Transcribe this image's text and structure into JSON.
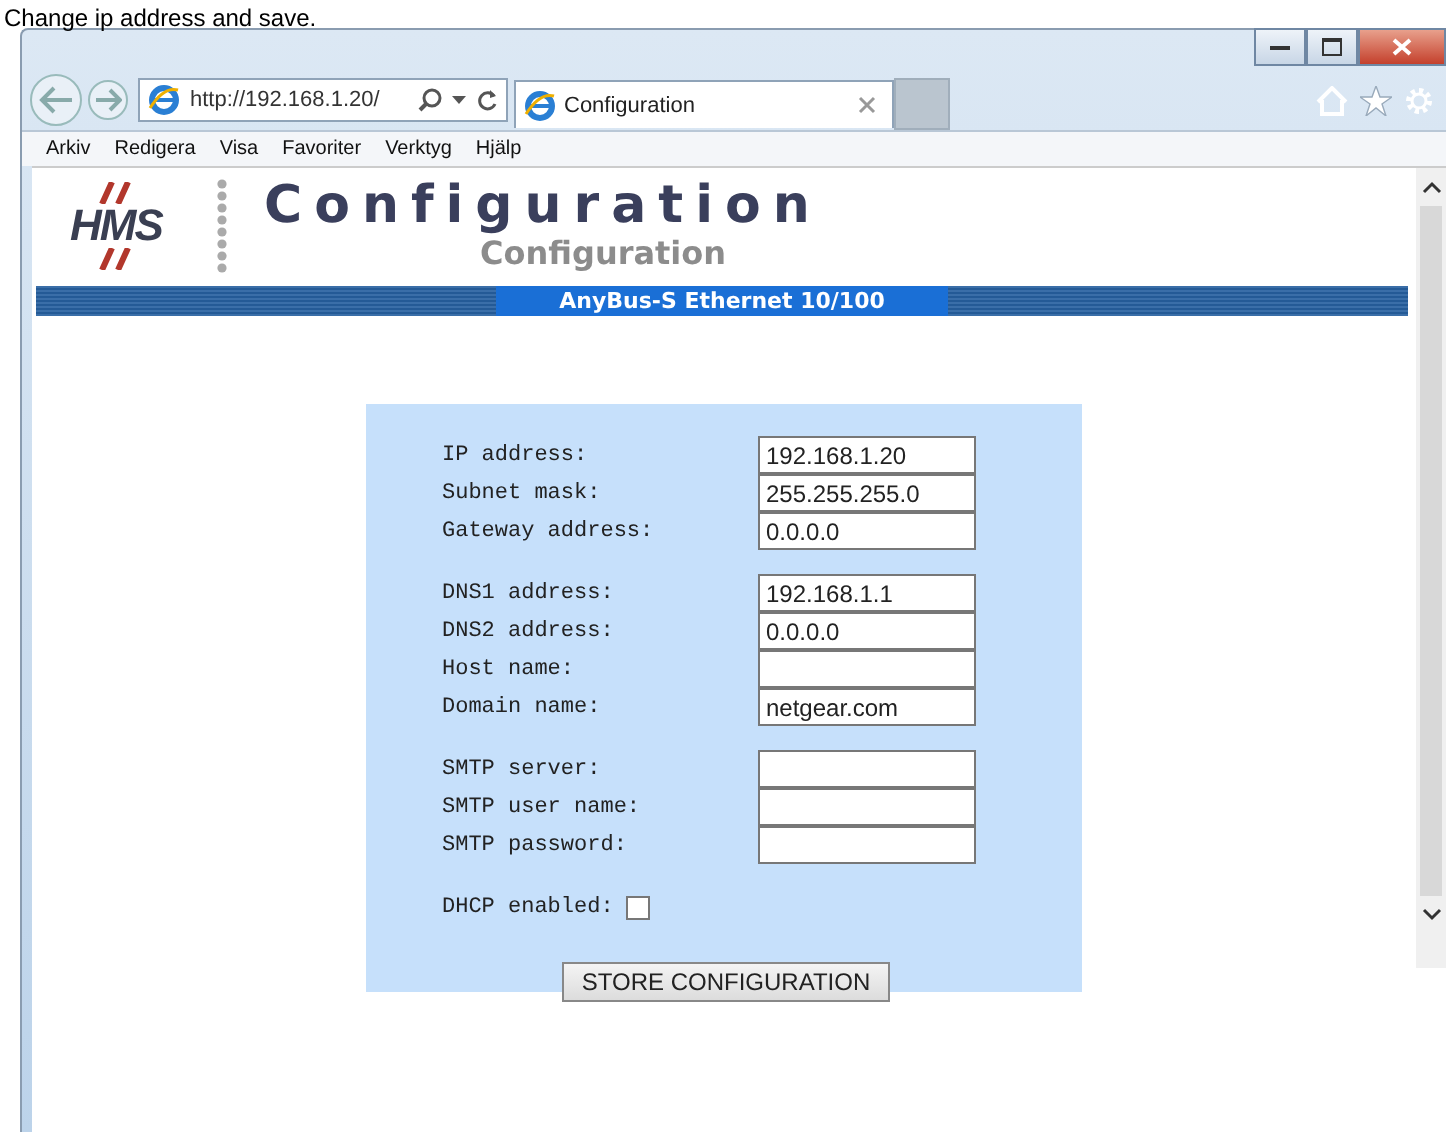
{
  "caption": "Change ip address and save.",
  "browser": {
    "address": "http://192.168.1.20/",
    "tabs": [
      {
        "title": "Configuration",
        "selected": true
      }
    ],
    "menu": [
      "Arkiv",
      "Redigera",
      "Visa",
      "Favoriter",
      "Verktyg",
      "Hjälp"
    ]
  },
  "page": {
    "logo": "HMS",
    "title": "Configuration",
    "title_shadow": "Configuration",
    "banner": "AnyBus-S Ethernet 10/100"
  },
  "form": {
    "groups": [
      [
        {
          "label": "IP address:",
          "value": "192.168.1.20"
        },
        {
          "label": "Subnet mask:",
          "value": "255.255.255.0"
        },
        {
          "label": "Gateway address:",
          "value": "0.0.0.0"
        }
      ],
      [
        {
          "label": "DNS1 address:",
          "value": "192.168.1.1"
        },
        {
          "label": "DNS2 address:",
          "value": "0.0.0.0"
        },
        {
          "label": "Host name:"
        },
        {
          "label": "Domain name:",
          "value": "netgear.com"
        }
      ],
      [
        {
          "label": "SMTP server:"
        },
        {
          "label": "SMTP user name:"
        },
        {
          "label": "SMTP password:"
        }
      ]
    ],
    "dhcp": {
      "label": "DHCP enabled:",
      "checked": false
    },
    "button": "STORE CONFIGURATION"
  }
}
